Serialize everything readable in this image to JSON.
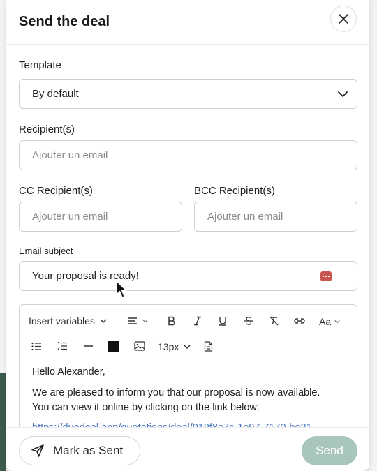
{
  "modal": {
    "title": "Send the deal",
    "close_icon": "close-icon"
  },
  "template": {
    "label": "Template",
    "value": "By default"
  },
  "recipients": {
    "label": "Recipient(s)",
    "placeholder": "Ajouter un email"
  },
  "cc": {
    "label": "CC Recipient(s)",
    "placeholder": "Ajouter un email"
  },
  "bcc": {
    "label": "BCC Recipient(s)",
    "placeholder": "Ajouter un email"
  },
  "subject": {
    "label": "Email subject",
    "value": "Your proposal is ready!"
  },
  "editor": {
    "insert_variables": "Insert variables",
    "font_size": "13px",
    "case_label": "Aa",
    "greeting": "Hello Alexander,",
    "line1": "We are pleased to inform you that our proposal is now available.",
    "line2": "You can view it online by clicking on the link below:",
    "link": "https://duodeal.app/quotations/deal/019f8e7c-1e97-7170-be21",
    "text_color": "#111111"
  },
  "footer": {
    "mark_as_sent": "Mark as Sent",
    "send": "Send"
  },
  "colors": {
    "send_button_bg": "#a9c6bd",
    "subject_icon": "#c9564e",
    "link": "#4a76c4"
  }
}
